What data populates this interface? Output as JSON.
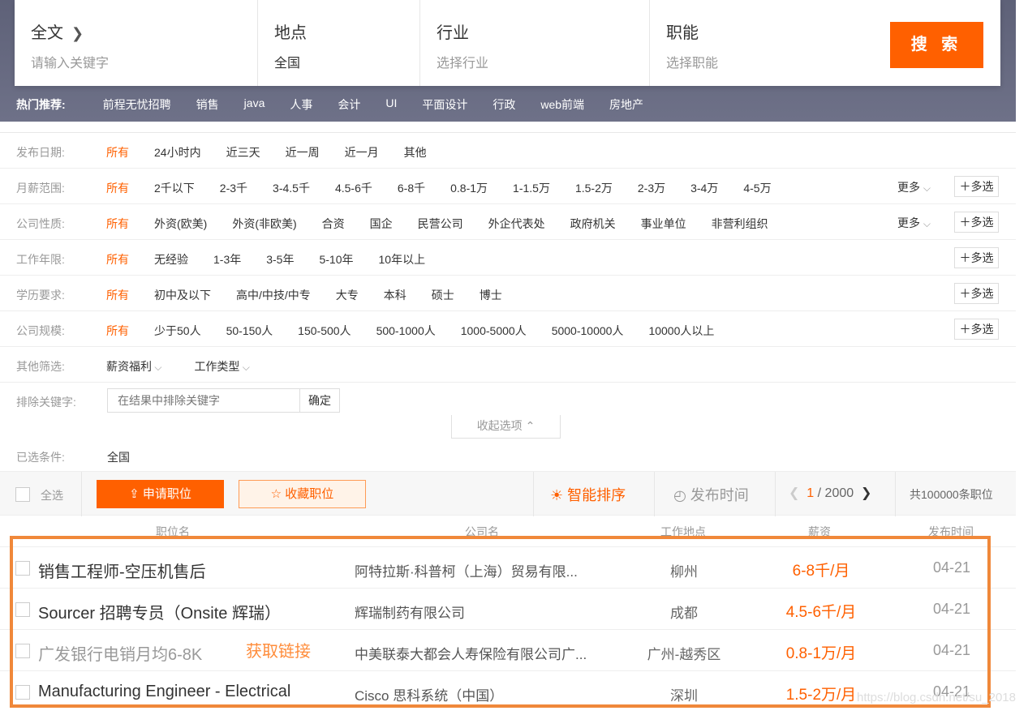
{
  "search": {
    "fulltext_label": "全文",
    "fulltext_placeholder": "请输入关键字",
    "location_label": "地点",
    "location_value": "全国",
    "industry_label": "行业",
    "industry_placeholder": "选择行业",
    "function_label": "职能",
    "function_placeholder": "选择职能",
    "search_button": "搜 索"
  },
  "hot": {
    "label": "热门推荐:",
    "items": [
      "前程无忧招聘",
      "销售",
      "java",
      "人事",
      "会计",
      "UI",
      "平面设计",
      "行政",
      "web前端",
      "房地产"
    ]
  },
  "filters": {
    "date": {
      "label": "发布日期:",
      "options": [
        "所有",
        "24小时内",
        "近三天",
        "近一周",
        "近一月",
        "其他"
      ]
    },
    "salary": {
      "label": "月薪范围:",
      "options": [
        "所有",
        "2千以下",
        "2-3千",
        "3-4.5千",
        "4.5-6千",
        "6-8千",
        "0.8-1万",
        "1-1.5万",
        "1.5-2万",
        "2-3万",
        "3-4万",
        "4-5万"
      ]
    },
    "company_type": {
      "label": "公司性质:",
      "options": [
        "所有",
        "外资(欧美)",
        "外资(非欧美)",
        "合资",
        "国企",
        "民营公司",
        "外企代表处",
        "政府机关",
        "事业单位",
        "非营利组织"
      ]
    },
    "experience": {
      "label": "工作年限:",
      "options": [
        "所有",
        "无经验",
        "1-3年",
        "3-5年",
        "5-10年",
        "10年以上"
      ]
    },
    "education": {
      "label": "学历要求:",
      "options": [
        "所有",
        "初中及以下",
        "高中/中技/中专",
        "大专",
        "本科",
        "硕士",
        "博士"
      ]
    },
    "size": {
      "label": "公司规模:",
      "options": [
        "所有",
        "少于50人",
        "50-150人",
        "150-500人",
        "500-1000人",
        "1000-5000人",
        "5000-10000人",
        "10000人以上"
      ]
    },
    "other": {
      "label": "其他筛选:",
      "welfare": "薪资福利",
      "job_type": "工作类型"
    },
    "exclude": {
      "label": "排除关键字:",
      "placeholder": "在结果中排除关键字",
      "confirm": "确定"
    },
    "more_label": "更多",
    "multi_label": "多选",
    "collapse_label": "收起选项",
    "selected_label": "已选条件:",
    "selected_value": "全国"
  },
  "toolbar": {
    "select_all": "全选",
    "apply": "申请职位",
    "favorite": "收藏职位",
    "sort_smart": "智能排序",
    "sort_time": "发布时间",
    "page_current": "1",
    "page_total": "/ 2000",
    "total_jobs": "共100000条职位"
  },
  "columns": {
    "job": "职位名",
    "company": "公司名",
    "location": "工作地点",
    "salary": "薪资",
    "date": "发布时间"
  },
  "jobs": [
    {
      "title": "销售工程师-空压机售后",
      "company": "阿特拉斯·科普柯（上海）贸易有限...",
      "location": "柳州",
      "salary": "6-8千/月",
      "date": "04-21"
    },
    {
      "title": "Sourcer 招聘专员（Onsite 辉瑞）",
      "company": "辉瑞制药有限公司",
      "location": "成都",
      "salary": "4.5-6千/月",
      "date": "04-21"
    },
    {
      "title": "广发银行电销月均6-8K",
      "company": "中美联泰大都会人寿保险有限公司广...",
      "location": "广州-越秀区",
      "salary": "0.8-1万/月",
      "date": "04-21"
    },
    {
      "title": "Manufacturing Engineer - Electrical",
      "company": "Cisco 思科系统（中国）",
      "location": "深圳",
      "salary": "1.5-2万/月",
      "date": "04-21"
    }
  ],
  "annotation": "获取链接",
  "watermark": "https://blog.csdn.net/su_2018",
  "colors": {
    "accent": "#ff6000",
    "highlight_border": "#f0883a",
    "banner": "#62657c"
  }
}
